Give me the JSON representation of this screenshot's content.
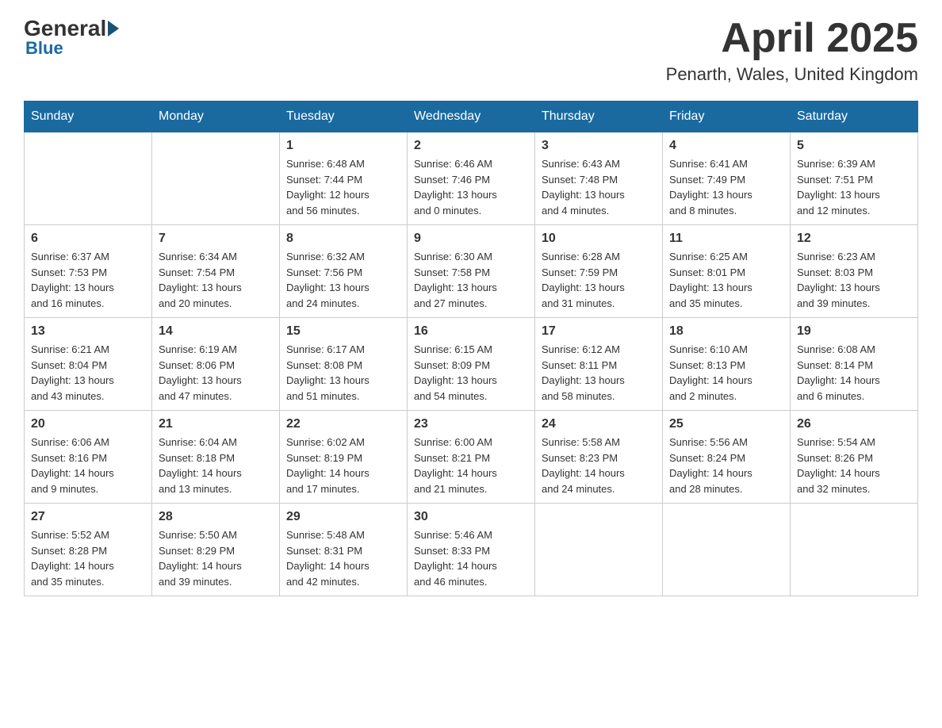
{
  "header": {
    "logo_general": "General",
    "logo_blue": "Blue",
    "month_title": "April 2025",
    "location": "Penarth, Wales, United Kingdom"
  },
  "days_of_week": [
    "Sunday",
    "Monday",
    "Tuesday",
    "Wednesday",
    "Thursday",
    "Friday",
    "Saturday"
  ],
  "weeks": [
    [
      {
        "day": "",
        "info": ""
      },
      {
        "day": "",
        "info": ""
      },
      {
        "day": "1",
        "info": "Sunrise: 6:48 AM\nSunset: 7:44 PM\nDaylight: 12 hours\nand 56 minutes."
      },
      {
        "day": "2",
        "info": "Sunrise: 6:46 AM\nSunset: 7:46 PM\nDaylight: 13 hours\nand 0 minutes."
      },
      {
        "day": "3",
        "info": "Sunrise: 6:43 AM\nSunset: 7:48 PM\nDaylight: 13 hours\nand 4 minutes."
      },
      {
        "day": "4",
        "info": "Sunrise: 6:41 AM\nSunset: 7:49 PM\nDaylight: 13 hours\nand 8 minutes."
      },
      {
        "day": "5",
        "info": "Sunrise: 6:39 AM\nSunset: 7:51 PM\nDaylight: 13 hours\nand 12 minutes."
      }
    ],
    [
      {
        "day": "6",
        "info": "Sunrise: 6:37 AM\nSunset: 7:53 PM\nDaylight: 13 hours\nand 16 minutes."
      },
      {
        "day": "7",
        "info": "Sunrise: 6:34 AM\nSunset: 7:54 PM\nDaylight: 13 hours\nand 20 minutes."
      },
      {
        "day": "8",
        "info": "Sunrise: 6:32 AM\nSunset: 7:56 PM\nDaylight: 13 hours\nand 24 minutes."
      },
      {
        "day": "9",
        "info": "Sunrise: 6:30 AM\nSunset: 7:58 PM\nDaylight: 13 hours\nand 27 minutes."
      },
      {
        "day": "10",
        "info": "Sunrise: 6:28 AM\nSunset: 7:59 PM\nDaylight: 13 hours\nand 31 minutes."
      },
      {
        "day": "11",
        "info": "Sunrise: 6:25 AM\nSunset: 8:01 PM\nDaylight: 13 hours\nand 35 minutes."
      },
      {
        "day": "12",
        "info": "Sunrise: 6:23 AM\nSunset: 8:03 PM\nDaylight: 13 hours\nand 39 minutes."
      }
    ],
    [
      {
        "day": "13",
        "info": "Sunrise: 6:21 AM\nSunset: 8:04 PM\nDaylight: 13 hours\nand 43 minutes."
      },
      {
        "day": "14",
        "info": "Sunrise: 6:19 AM\nSunset: 8:06 PM\nDaylight: 13 hours\nand 47 minutes."
      },
      {
        "day": "15",
        "info": "Sunrise: 6:17 AM\nSunset: 8:08 PM\nDaylight: 13 hours\nand 51 minutes."
      },
      {
        "day": "16",
        "info": "Sunrise: 6:15 AM\nSunset: 8:09 PM\nDaylight: 13 hours\nand 54 minutes."
      },
      {
        "day": "17",
        "info": "Sunrise: 6:12 AM\nSunset: 8:11 PM\nDaylight: 13 hours\nand 58 minutes."
      },
      {
        "day": "18",
        "info": "Sunrise: 6:10 AM\nSunset: 8:13 PM\nDaylight: 14 hours\nand 2 minutes."
      },
      {
        "day": "19",
        "info": "Sunrise: 6:08 AM\nSunset: 8:14 PM\nDaylight: 14 hours\nand 6 minutes."
      }
    ],
    [
      {
        "day": "20",
        "info": "Sunrise: 6:06 AM\nSunset: 8:16 PM\nDaylight: 14 hours\nand 9 minutes."
      },
      {
        "day": "21",
        "info": "Sunrise: 6:04 AM\nSunset: 8:18 PM\nDaylight: 14 hours\nand 13 minutes."
      },
      {
        "day": "22",
        "info": "Sunrise: 6:02 AM\nSunset: 8:19 PM\nDaylight: 14 hours\nand 17 minutes."
      },
      {
        "day": "23",
        "info": "Sunrise: 6:00 AM\nSunset: 8:21 PM\nDaylight: 14 hours\nand 21 minutes."
      },
      {
        "day": "24",
        "info": "Sunrise: 5:58 AM\nSunset: 8:23 PM\nDaylight: 14 hours\nand 24 minutes."
      },
      {
        "day": "25",
        "info": "Sunrise: 5:56 AM\nSunset: 8:24 PM\nDaylight: 14 hours\nand 28 minutes."
      },
      {
        "day": "26",
        "info": "Sunrise: 5:54 AM\nSunset: 8:26 PM\nDaylight: 14 hours\nand 32 minutes."
      }
    ],
    [
      {
        "day": "27",
        "info": "Sunrise: 5:52 AM\nSunset: 8:28 PM\nDaylight: 14 hours\nand 35 minutes."
      },
      {
        "day": "28",
        "info": "Sunrise: 5:50 AM\nSunset: 8:29 PM\nDaylight: 14 hours\nand 39 minutes."
      },
      {
        "day": "29",
        "info": "Sunrise: 5:48 AM\nSunset: 8:31 PM\nDaylight: 14 hours\nand 42 minutes."
      },
      {
        "day": "30",
        "info": "Sunrise: 5:46 AM\nSunset: 8:33 PM\nDaylight: 14 hours\nand 46 minutes."
      },
      {
        "day": "",
        "info": ""
      },
      {
        "day": "",
        "info": ""
      },
      {
        "day": "",
        "info": ""
      }
    ]
  ]
}
